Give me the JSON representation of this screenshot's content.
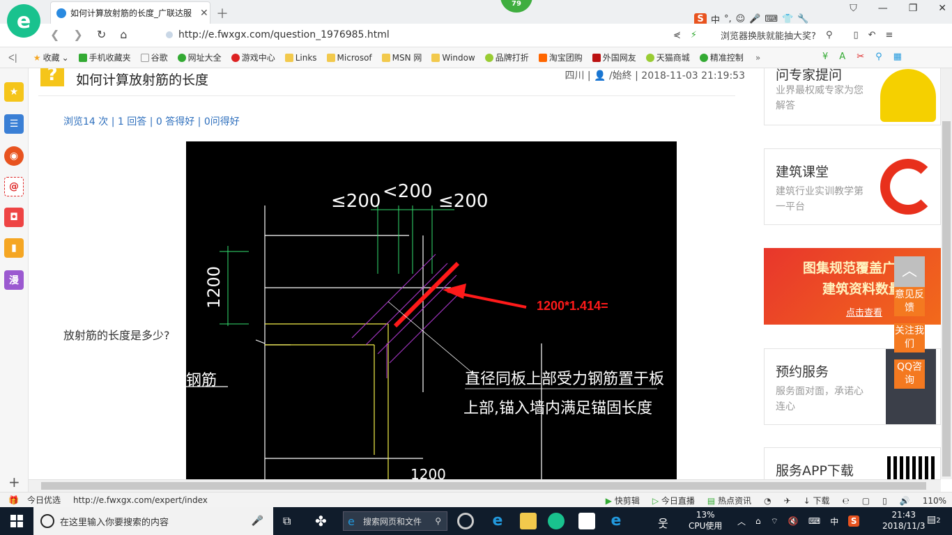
{
  "browser": {
    "tab_title": "如何计算放射筋的长度_广联达服",
    "badge": "79",
    "url": "http://e.fwxgx.com/question_1976985.html",
    "promo": "浏览器换肤就能抽大奖?"
  },
  "bookmarks": [
    "收藏",
    "手机收藏夹",
    "谷歌",
    "网址大全",
    "游戏中心",
    "Links",
    "Microsof",
    "MSN 网",
    "Window",
    "品牌打折",
    "淘宝团购",
    "外国网友",
    "天猫商城",
    "精准控制"
  ],
  "sidebar_icons": [
    "star-icon",
    "apps-icon",
    "weibo-icon",
    "mail-icon",
    "game-icon",
    "book-icon",
    "comic-icon"
  ],
  "sidebar_comic": "漫",
  "question": {
    "title": "如何计算放射筋的长度",
    "meta": "四川 | ",
    "author": "/始終",
    "date": " | 2018-11-03 21:19:53",
    "stats": "浏览14 次 | 1 回答 | 0 答得好 | 0问得好",
    "body": "放射筋的长度是多少?"
  },
  "drawing": {
    "dim_top": [
      "≤200",
      "<200",
      "≤200"
    ],
    "dim_left": "1200",
    "annotation": "1200*1.414=",
    "note_line1": "直径同板上部受力钢筋置于板",
    "note_line2": "上部,锚入墙内满足锚固长度",
    "left_label": "钢筋",
    "bottom_dim": "1200"
  },
  "right": {
    "card1_title": "问专家提问",
    "card1_sub": "业界最权威专家为您解答",
    "card2_title": "建筑课堂",
    "card2_sub": "建筑行业实训教学第一平台",
    "banner_line1": "图集规范覆盖广",
    "banner_line2": "建筑资料数量多",
    "banner_link": "点击查看",
    "card3_title": "预约服务",
    "card3_sub": "服务面对面，承诺心连心",
    "card4_title": "服务APP下载"
  },
  "float_buttons": [
    "意见反馈",
    "关注我们",
    "QQ咨询"
  ],
  "status": {
    "today": "今日优选",
    "link": "http://e.fwxgx.com/expert/index",
    "items": [
      "快剪辑",
      "今日直播",
      "热点资讯",
      "下载"
    ],
    "zoom": "110%"
  },
  "taskbar": {
    "search_placeholder": "在这里输入你要搜索的内容",
    "web_search": "搜索网页和文件",
    "cpu_pct": "13%",
    "cpu_label": "CPU使用",
    "ime": "中",
    "time": "21:43",
    "date": "2018/11/3",
    "notif": "2"
  },
  "colors": {
    "accent": "#19c28e",
    "orange": "#f47920",
    "link": "#2e6fbd",
    "red": "#ff1a1a"
  }
}
